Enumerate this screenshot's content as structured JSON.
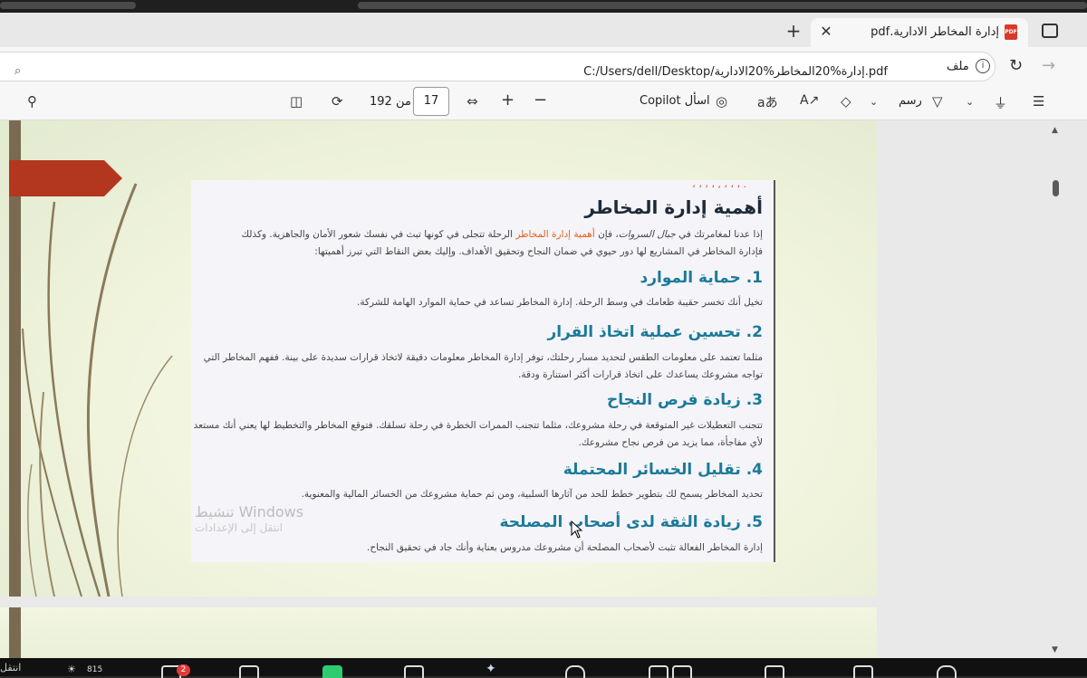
{
  "browser": {
    "tab": {
      "title": "إدارة المخاطر الادارية.pdf",
      "pdf_badge": "PDF"
    },
    "address": {
      "file_label": "ملف",
      "url": "C:/Users/dell/Desktop/إدارة%20المخاطر%20الادارية.pdf"
    }
  },
  "toolbar": {
    "current_page": "17",
    "page_of": "من 192",
    "copilot_label": "اسأل Copilot",
    "draw_label": "رسم"
  },
  "slide": {
    "title": "أهمية إدارة المخاطر",
    "intro_line1_a": "إذا عدنا لمغامرتك في ",
    "intro_line1_em": "جبال السروات",
    "intro_line1_b": "، فإن ",
    "intro_line1_hl": "أهمية إدارة المخاطر",
    "intro_line1_c": " الرحلة تتجلى في كونها تبث في نفسك شعور الأمان والجاهزية. وكذلك",
    "intro_line2": "فإدارة المخاطر في المشاريع لها دور حيوي في ضمان النجاح وتحقيق الأهداف. وإليك بعض النقاط التي تبرز أهميتها:",
    "sections": [
      {
        "heading": "1. حماية الموارد",
        "text": "تخيل أنك تخسر حقيبة طعامك في وسط الرحلة. إدارة المخاطر تساعد في حماية الموارد الهامة للشركة."
      },
      {
        "heading": "2. تحسين عملية اتخاذ القرار",
        "text": "مثلما تعتمد على معلومات الطقس لتحديد مسار رحلتك، توفر إدارة المخاطر معلومات دقيقة لاتخاذ قرارات سديدة على بينة. ففهم المخاطر التي تواجه مشروعك يساعدك على اتخاذ قرارات أكثر استنارة ودقة."
      },
      {
        "heading": "3. زيادة فرص النجاح",
        "text": "تتجنب التعطيلات غير المتوقعة في رحلة مشروعك، مثلما تتجنب الممرات الخطرة في رحلة تسلقك. فتوقع المخاطر والتخطيط لها يعني أنك مستعد لأي مفاجأة، مما يزيد من فرص نجاح مشروعك."
      },
      {
        "heading": "4. تقليل الخسائر المحتملة",
        "text": "تحديد المخاطر يسمح لك بتطوير خطط للحد من آثارها السلبية، ومن ثم حماية مشروعك من الخسائر المالية والمعنوية."
      },
      {
        "heading": "5. زيادة الثقة لدى أصحاب المصلحة",
        "text": "إدارة المخاطر الفعالة تثبت لأصحاب المصلحة أن مشروعك مدروس بعناية وأنك جاد في تحقيق النجاح."
      }
    ]
  },
  "watermark": {
    "line1": "تنشيط Windows",
    "line2": "انتقل إلى الإعدادات"
  },
  "taskbar": {
    "badge_count": "2",
    "count_label": "815",
    "side_text": "انتقل"
  },
  "colors": {
    "accent_heading": "#1b7a9a",
    "highlight": "#e0601d",
    "arrow": "#b3361f",
    "side_bar": "#7b6a52"
  },
  "icons": [
    "search-icon",
    "reload-icon",
    "forward-icon",
    "info-icon",
    "close-icon",
    "plus-icon",
    "zoom-in-icon",
    "zoom-out-icon",
    "fit-width-icon",
    "rotate-icon",
    "two-page-icon",
    "copilot-icon",
    "translate-icon",
    "read-aloud-icon",
    "eraser-icon",
    "draw-icon",
    "highlight-icon",
    "contents-icon"
  ]
}
